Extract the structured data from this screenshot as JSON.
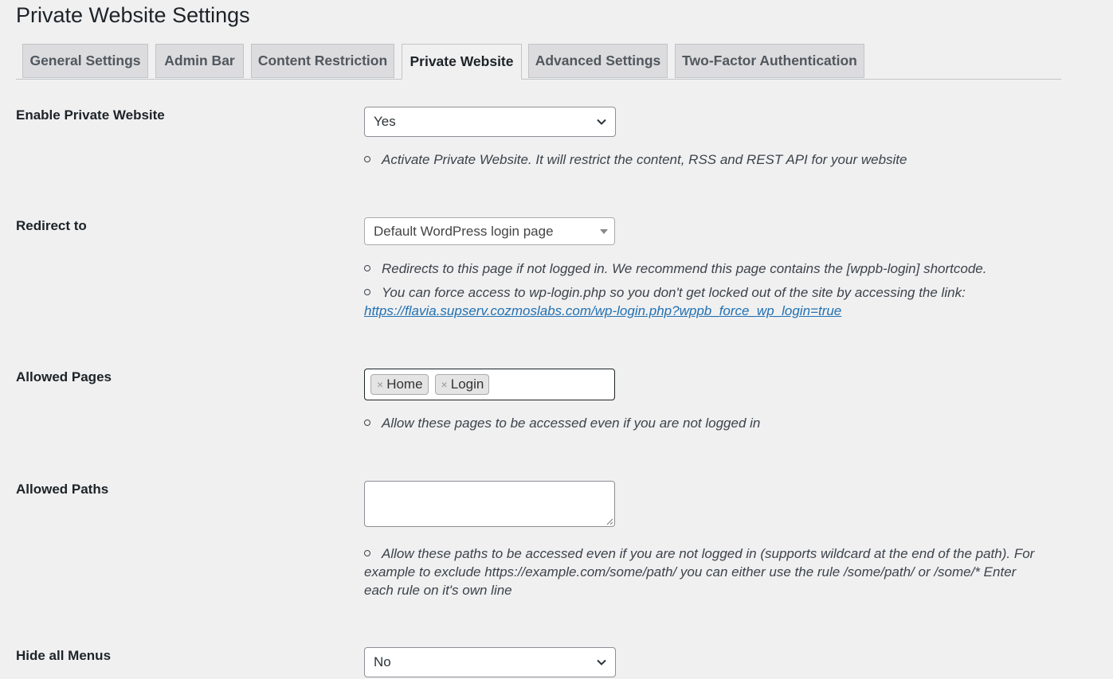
{
  "page": {
    "title": "Private Website Settings"
  },
  "tabs": [
    {
      "label": "General Settings",
      "active": false
    },
    {
      "label": "Admin Bar",
      "active": false
    },
    {
      "label": "Content Restriction",
      "active": false
    },
    {
      "label": "Private Website",
      "active": true
    },
    {
      "label": "Advanced Settings",
      "active": false
    },
    {
      "label": "Two-Factor Authentication",
      "active": false
    }
  ],
  "enable_private": {
    "label": "Enable Private Website",
    "value": "Yes",
    "desc": "Activate Private Website. It will restrict the content, RSS and REST API for your website"
  },
  "redirect": {
    "label": "Redirect to",
    "value": "Default WordPress login page",
    "desc1": "Redirects to this page if not logged in. We recommend this page contains the [wppb-login] shortcode.",
    "desc2": "You can force access to wp-login.php so you don't get locked out of the site by accessing the link:",
    "link": "https://flavia.supserv.cozmoslabs.com/wp-login.php?wppb_force_wp_login=true"
  },
  "allowed_pages": {
    "label": "Allowed Pages",
    "chips": [
      "Home",
      "Login"
    ],
    "chip_remove": "×",
    "desc": "Allow these pages to be accessed even if you are not logged in"
  },
  "allowed_paths": {
    "label": "Allowed Paths",
    "value": "",
    "desc_line1": "Allow these paths to be accessed even if you are not logged in (supports wildcard at the end of the path). For",
    "desc_line2": "example to exclude https://example.com/some/path/ you can either use the rule /some/path/ or /some/* Enter",
    "desc_line3": "each rule on it's own line"
  },
  "hide_menus": {
    "label": "Hide all Menus",
    "value": "No"
  },
  "colors": {
    "background": "#f0f0f1",
    "link": "#2271b1",
    "tab_inactive": "#dcdcde"
  }
}
